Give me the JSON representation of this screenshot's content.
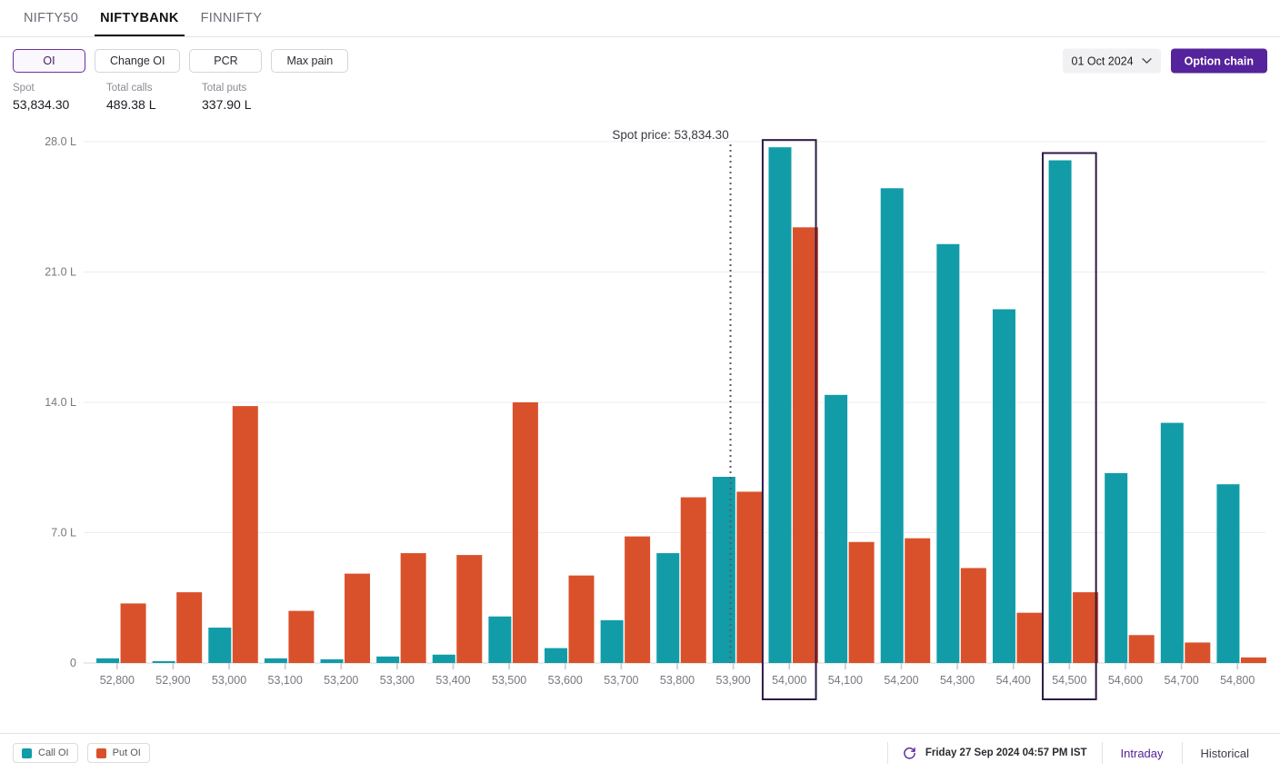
{
  "tabs": [
    {
      "label": "NIFTY50",
      "active": false
    },
    {
      "label": "NIFTYBANK",
      "active": true
    },
    {
      "label": "FINNIFTY",
      "active": false
    }
  ],
  "controls": {
    "buttons": [
      {
        "label": "OI",
        "selected": true
      },
      {
        "label": "Change OI",
        "selected": false
      },
      {
        "label": "PCR",
        "selected": false
      },
      {
        "label": "Max pain",
        "selected": false
      }
    ],
    "expiry": "01 Oct 2024",
    "expiry_icon": "chevron-down-icon",
    "option_chain_label": "Option chain"
  },
  "stats": [
    {
      "label": "Spot",
      "value": "53,834.30"
    },
    {
      "label": "Total calls",
      "value": "489.38 L"
    },
    {
      "label": "Total puts",
      "value": "337.90 L"
    }
  ],
  "footer": {
    "legend": [
      {
        "label": "Call OI",
        "color": "#119ca8"
      },
      {
        "label": "Put OI",
        "color": "#d9512b"
      }
    ],
    "refresh_icon": "refresh-icon",
    "timestamp": "Friday 27 Sep 2024 04:57 PM IST",
    "links": [
      {
        "label": "Intraday",
        "active": true
      },
      {
        "label": "Historical",
        "active": false
      }
    ]
  },
  "chart_data": {
    "type": "bar",
    "title": "",
    "xlabel": "",
    "ylabel": "",
    "grid": true,
    "legend_position": "bottom-left",
    "ylim": [
      0,
      28
    ],
    "yticks": [
      0,
      7,
      14,
      21,
      28
    ],
    "ytick_labels": [
      "0",
      "7.0 L",
      "14.0 L",
      "21.0 L",
      "28.0 L"
    ],
    "unit": "L",
    "categories": [
      "52,800",
      "52,900",
      "53,000",
      "53,100",
      "53,200",
      "53,300",
      "53,400",
      "53,500",
      "53,600",
      "53,700",
      "53,800",
      "53,900",
      "54,000",
      "54,100",
      "54,200",
      "54,300",
      "54,400",
      "54,500",
      "54,600",
      "54,700",
      "54,800"
    ],
    "series": [
      {
        "name": "Call OI",
        "color": "#119ca8",
        "values": [
          0.25,
          0.1,
          1.9,
          0.25,
          0.2,
          0.35,
          0.45,
          2.5,
          0.8,
          2.3,
          5.9,
          10.0,
          27.7,
          14.4,
          25.5,
          22.5,
          19.0,
          27.0,
          10.2,
          12.9,
          9.6
        ]
      },
      {
        "name": "Put OI",
        "color": "#d9512b",
        "values": [
          3.2,
          3.8,
          13.8,
          2.8,
          4.8,
          5.9,
          5.8,
          14.0,
          4.7,
          6.8,
          8.9,
          9.2,
          23.4,
          6.5,
          6.7,
          5.1,
          2.7,
          3.8,
          1.5,
          1.1,
          0.3
        ]
      }
    ],
    "annotations": [
      {
        "type": "vline",
        "label": "Spot price: 53,834.30",
        "value": "53,834.30",
        "x_position": 11.45,
        "style": "dotted"
      }
    ],
    "highlighted_categories": [
      "54,000",
      "54,500"
    ],
    "highlight_color": "#2e1a47"
  }
}
